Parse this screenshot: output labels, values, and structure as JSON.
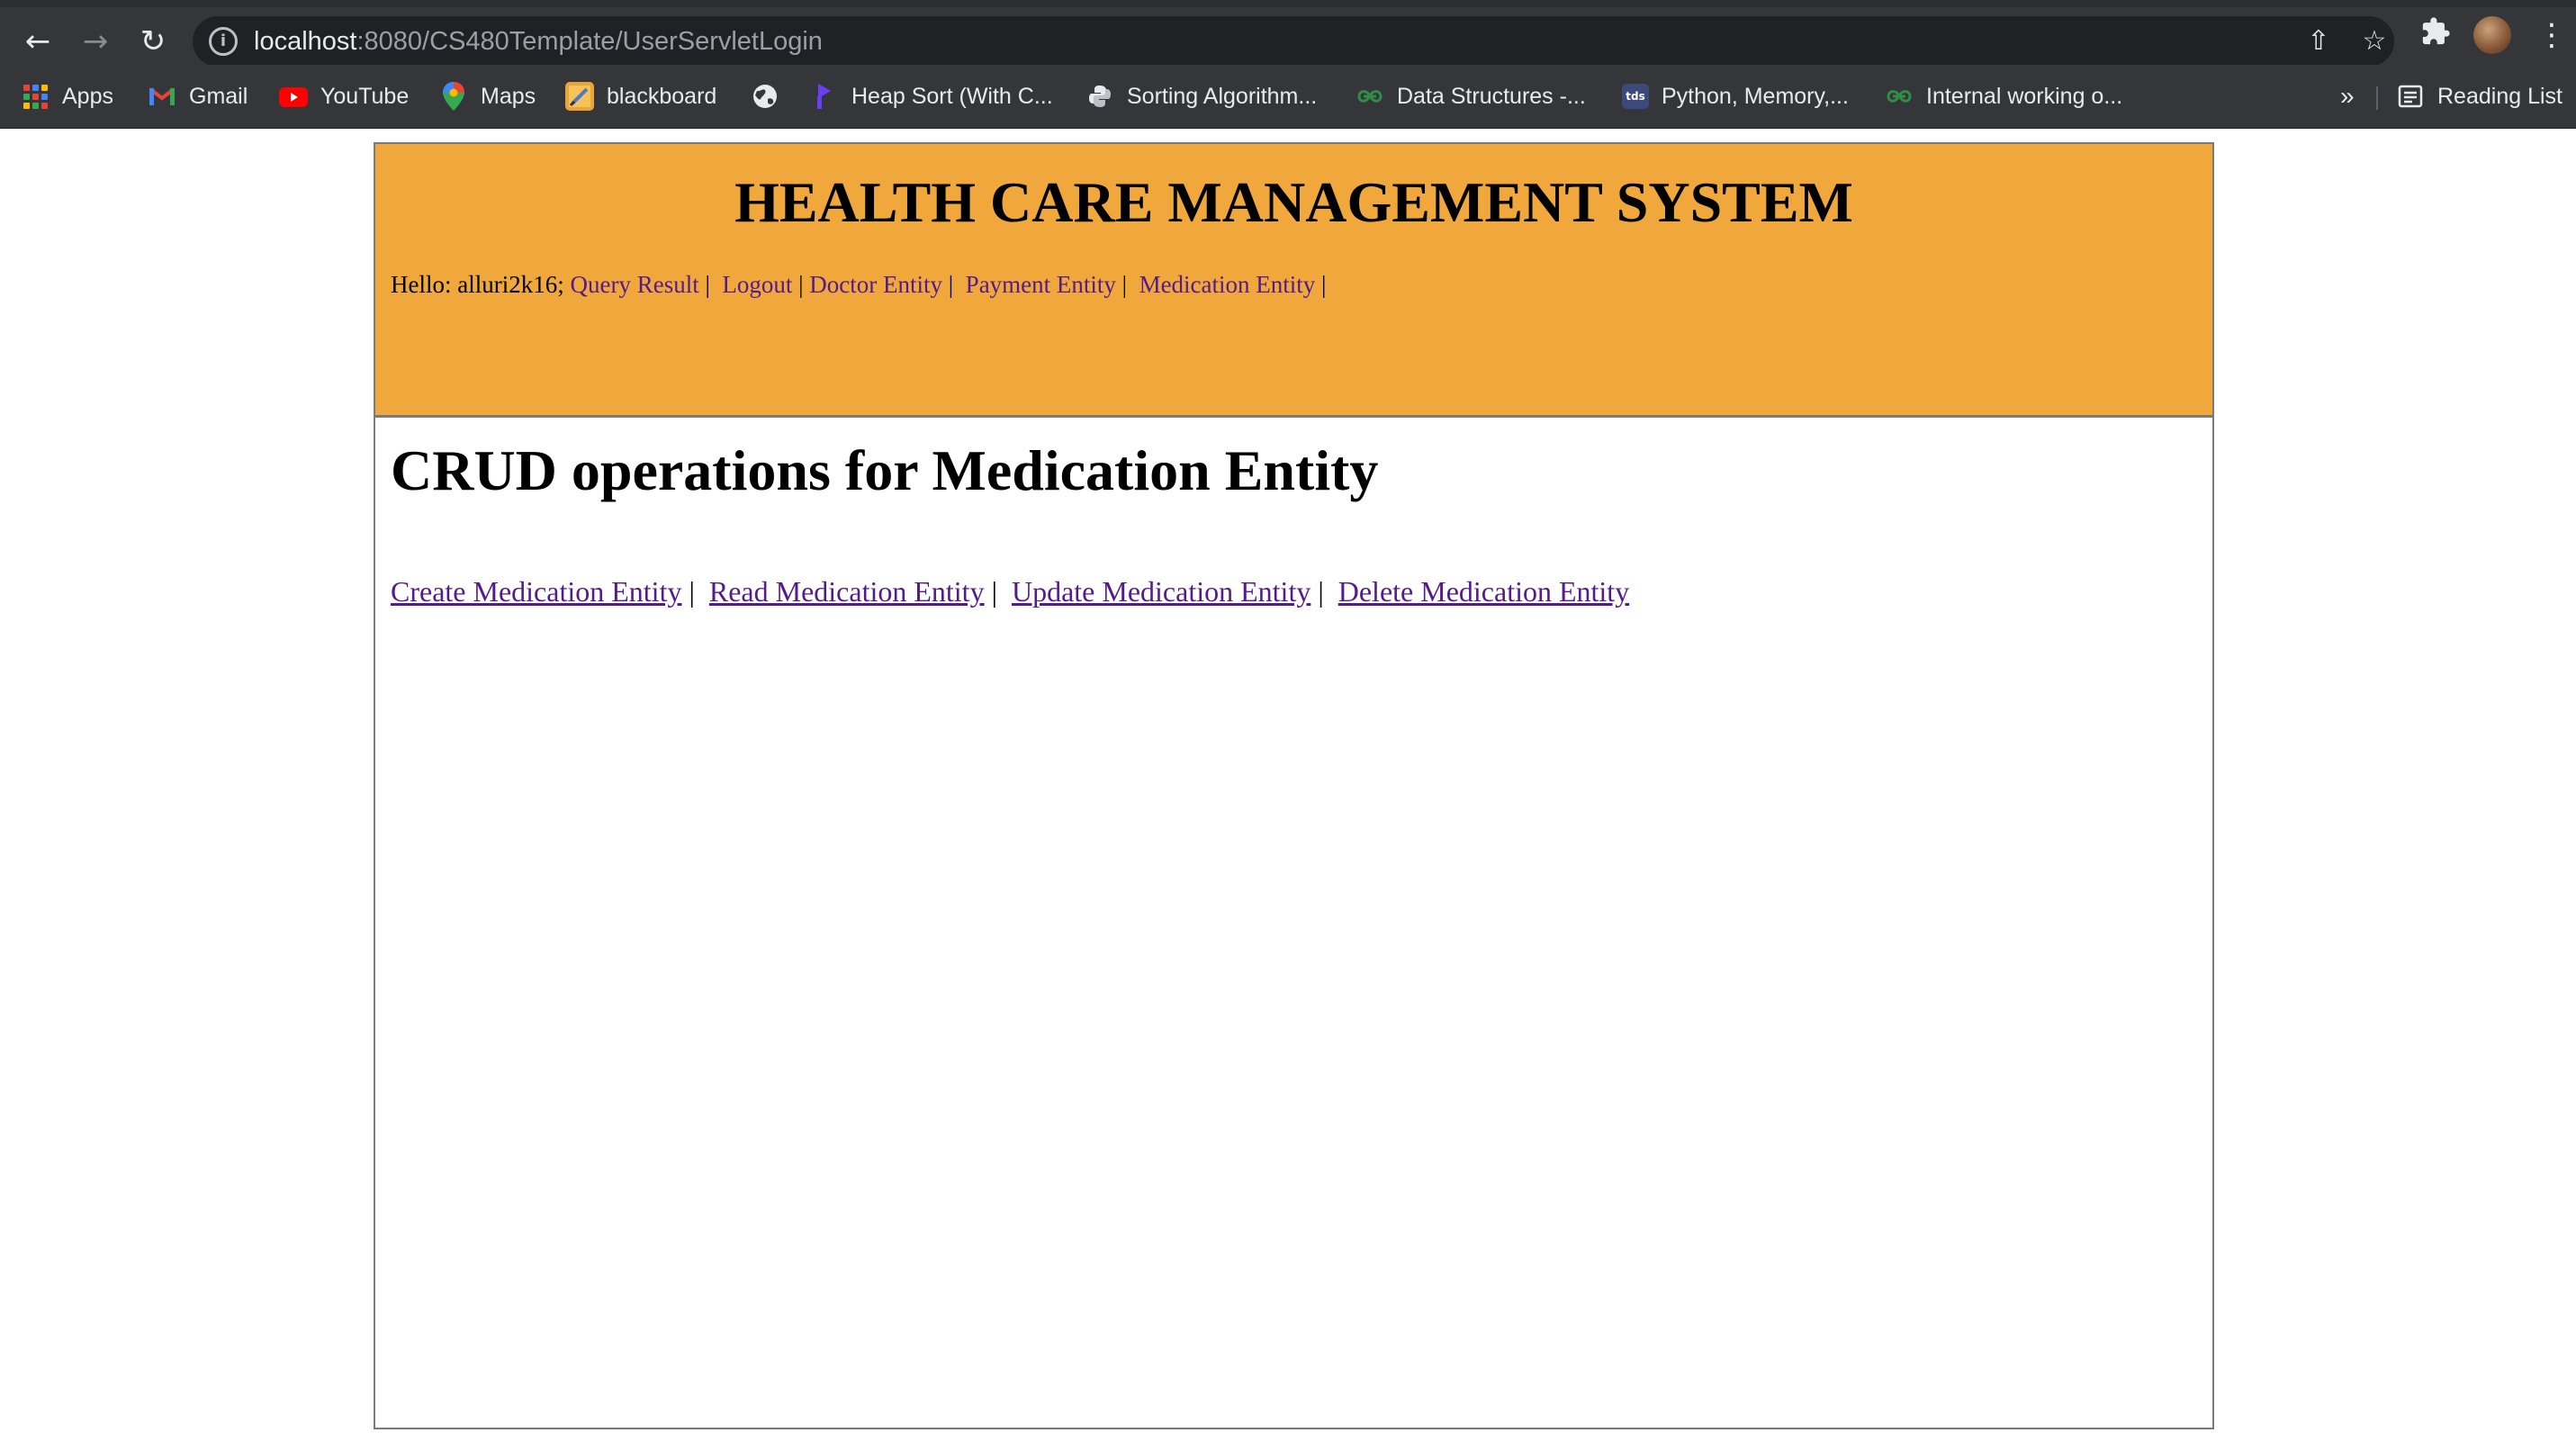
{
  "browser": {
    "url_host": "localhost",
    "url_rest": ":8080/CS480Template/UserServletLogin",
    "bookmarks": [
      {
        "label": "Apps",
        "icon": "apps-grid-icon"
      },
      {
        "label": "Gmail",
        "icon": "gmail-icon"
      },
      {
        "label": "YouTube",
        "icon": "youtube-icon"
      },
      {
        "label": "Maps",
        "icon": "maps-pin-icon"
      },
      {
        "label": "blackboard",
        "icon": "blackboard-icon"
      },
      {
        "label": "",
        "icon": "globe-icon"
      },
      {
        "label": "Heap Sort (With C...",
        "icon": "programiz-icon"
      },
      {
        "label": "Sorting Algorithm...",
        "icon": "python-icon"
      },
      {
        "label": "Data Structures -...",
        "icon": "geeksforgeeks-icon"
      },
      {
        "label": "Python, Memory,...",
        "icon": "tds-icon"
      },
      {
        "label": "Internal working o...",
        "icon": "geeksforgeeks-icon"
      }
    ],
    "overflow_label": "»",
    "reading_list_label": "Reading List"
  },
  "header": {
    "title": "HEALTH CARE MANAGEMENT SYSTEM",
    "hello_label": "Hello: ",
    "username": "alluri2k16;",
    "nav": [
      "Query Result",
      "Logout",
      "Doctor Entity",
      "Payment Entity",
      "Medication Entity"
    ],
    "separator": "|"
  },
  "main": {
    "heading": "CRUD operations for Medication Entity",
    "links": [
      "Create Medication Entity",
      "Read Medication Entity",
      "Update Medication Entity",
      "Delete Medication Entity"
    ],
    "separator": "|"
  },
  "colors": {
    "header_band": "#f0a83c",
    "link_visited": "#551a8b",
    "chrome_dark": "#202124",
    "chrome_toolbar": "#35363a"
  }
}
